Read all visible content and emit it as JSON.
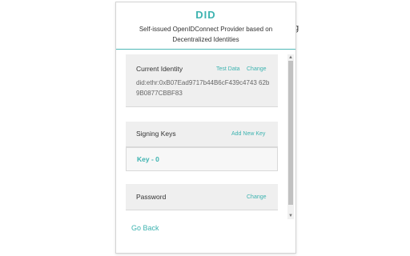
{
  "background_glyph": "g",
  "header": {
    "title": "DID",
    "subtitle": "Self-issued OpenIDConnect Provider based on Decentralized Identities"
  },
  "current_identity": {
    "label": "Current Identity",
    "test_data_link": "Test Data",
    "change_link": "Change",
    "did": "did:ethr:0xB07Ead9717b44B6cF439c4743 62b9B0877CBBF83"
  },
  "signing_keys": {
    "label": "Signing Keys",
    "add_link": "Add New Key",
    "keys": [
      "Key - 0"
    ]
  },
  "password": {
    "label": "Password",
    "change_link": "Change"
  },
  "footer": {
    "go_back": "Go Back"
  },
  "scrollbar": {
    "up_arrow": "▲",
    "down_arrow": "▼"
  },
  "colors": {
    "accent": "#3db3b0",
    "card_bg": "#efefef",
    "text": "#333333"
  }
}
